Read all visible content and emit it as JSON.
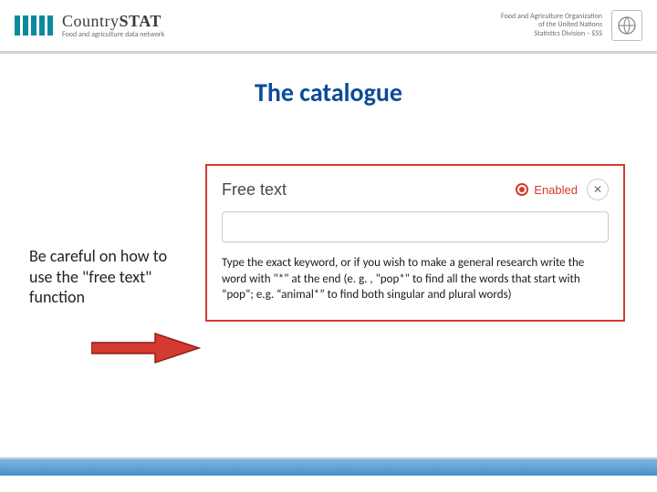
{
  "header": {
    "brand_main_light": "Country",
    "brand_main_bold": "STAT",
    "brand_sub": "Food and agriculture data network",
    "org_line1": "Food and Agriculture Organization",
    "org_line2": "of the United Nations",
    "org_line3": "Statistics Division – ESS"
  },
  "title": "The catalogue",
  "caption": "Be careful on how to use the \"free text\" function",
  "panel": {
    "heading": "Free text",
    "toggle_label": "Enabled",
    "input_value": "",
    "input_placeholder": "",
    "help": "Type the exact keyword, or if you wish to make a general research write the word with \"*\" at the end (e. g. , \"pop*\" to find all the words that start with “pop”; e.g. “animal*” to find both singular and plural words)"
  },
  "colors": {
    "accent_red": "#d43a2f",
    "title_blue": "#0b4b9a",
    "brand_teal": "#0b8a9f"
  }
}
